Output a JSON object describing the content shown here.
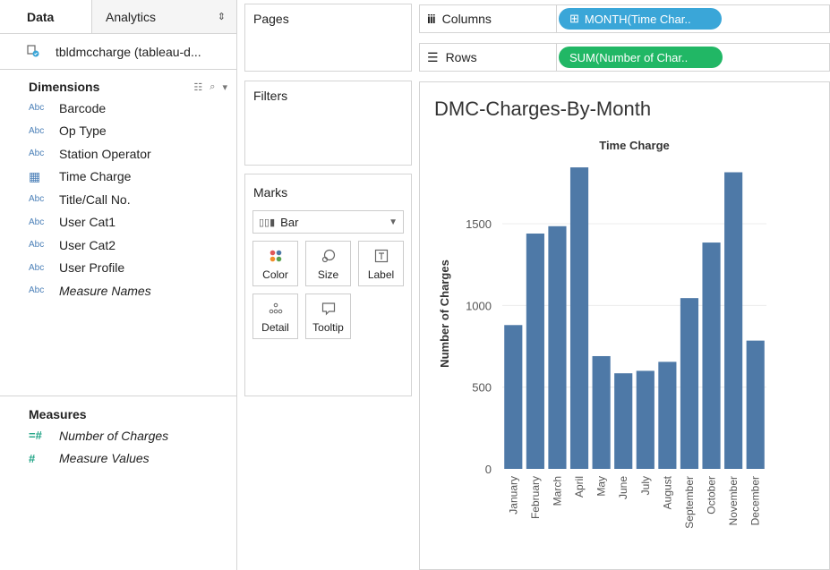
{
  "data_pane": {
    "tabs": [
      {
        "label": "Data",
        "active": true
      },
      {
        "label": "Analytics",
        "active": false
      }
    ],
    "datasource": "tbldmccharge (tableau-d...",
    "dimensions_header": "Dimensions",
    "dimensions": [
      {
        "type": "Abc",
        "name": "Barcode",
        "italic": false
      },
      {
        "type": "Abc",
        "name": "Op Type",
        "italic": false
      },
      {
        "type": "Abc",
        "name": "Station Operator",
        "italic": false
      },
      {
        "type": "date",
        "name": "Time Charge",
        "italic": false
      },
      {
        "type": "Abc",
        "name": "Title/Call No.",
        "italic": false
      },
      {
        "type": "Abc",
        "name": "User Cat1",
        "italic": false
      },
      {
        "type": "Abc",
        "name": "User Cat2",
        "italic": false
      },
      {
        "type": "Abc",
        "name": "User Profile",
        "italic": false
      },
      {
        "type": "Abc",
        "name": "Measure Names",
        "italic": true
      }
    ],
    "measures_header": "Measures",
    "measures": [
      {
        "type": "=#",
        "name": "Number of Charges",
        "italic": true
      },
      {
        "type": "#",
        "name": "Measure Values",
        "italic": true
      }
    ]
  },
  "pages_title": "Pages",
  "filters_title": "Filters",
  "marks": {
    "title": "Marks",
    "mark_type": "Bar",
    "buttons": [
      "Color",
      "Size",
      "Label",
      "Detail",
      "Tooltip"
    ]
  },
  "columns_shelf": {
    "label": "Columns",
    "pill": "MONTH(Time Char.."
  },
  "rows_shelf": {
    "label": "Rows",
    "pill": "SUM(Number of Char.."
  },
  "sheet_title": "DMC-Charges-By-Month",
  "colors": {
    "bar": "#4e79a7",
    "dimension_pill": "#3aa6d8",
    "measure_pill": "#21b765"
  },
  "chart_data": {
    "type": "bar",
    "title": "Time Charge",
    "ylabel": "Number of Charges",
    "xlabel": "",
    "categories": [
      "January",
      "February",
      "March",
      "April",
      "May",
      "June",
      "July",
      "August",
      "September",
      "October",
      "November",
      "December"
    ],
    "values": [
      880,
      1440,
      1485,
      1845,
      690,
      585,
      600,
      655,
      1045,
      1385,
      1815,
      785
    ],
    "ylim": [
      0,
      1900
    ],
    "yticks": [
      0,
      500,
      1000,
      1500
    ],
    "grid": true
  }
}
